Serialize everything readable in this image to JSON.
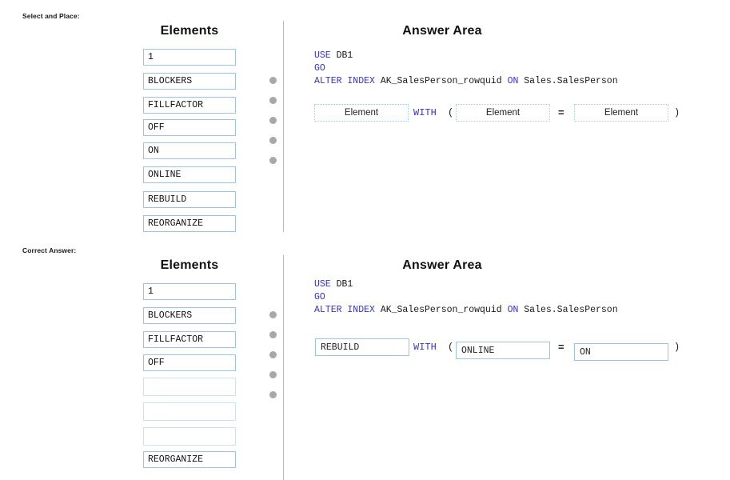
{
  "sections": [
    {
      "label": "Select and Place:",
      "elements_heading": "Elements",
      "answer_heading": "Answer Area",
      "elements": [
        {
          "text": "1",
          "empty": false
        },
        {
          "text": "BLOCKERS",
          "empty": false
        },
        {
          "text": "FILLFACTOR",
          "empty": false
        },
        {
          "text": "OFF",
          "empty": false
        },
        {
          "text": "ON",
          "empty": false
        },
        {
          "text": "ONLINE",
          "empty": false
        },
        {
          "text": "REBUILD",
          "empty": false
        },
        {
          "text": "REORGANIZE",
          "empty": false
        }
      ],
      "code": {
        "line1_kw": "USE",
        "line1_rest": " DB1",
        "line2_kw": "GO",
        "line3_kw": "ALTER INDEX",
        "line3_ident": " AK_SalesPerson_rowquid ",
        "line3_on": "ON",
        "line3_table": " Sales.SalesPerson"
      },
      "answer_row": {
        "slot1": "Element",
        "with_keyword": "WITH",
        "open_paren": "(",
        "slot2": "Element",
        "equals": "=",
        "slot3": "Element",
        "close_paren": ")"
      },
      "dots": 5
    },
    {
      "label": "Correct Answer:",
      "elements_heading": "Elements",
      "answer_heading": "Answer Area",
      "elements": [
        {
          "text": "1",
          "empty": false
        },
        {
          "text": "BLOCKERS",
          "empty": false
        },
        {
          "text": "FILLFACTOR",
          "empty": false
        },
        {
          "text": "OFF",
          "empty": false
        },
        {
          "text": "",
          "empty": true
        },
        {
          "text": "",
          "empty": true
        },
        {
          "text": "",
          "empty": true
        },
        {
          "text": "REORGANIZE",
          "empty": false
        }
      ],
      "code": {
        "line1_kw": "USE",
        "line1_rest": " DB1",
        "line2_kw": "GO",
        "line3_kw": "ALTER INDEX",
        "line3_ident": " AK_SalesPerson_rowquid ",
        "line3_on": "ON",
        "line3_table": " Sales.SalesPerson"
      },
      "answer_row": {
        "slot1": "REBUILD",
        "with_keyword": "WITH",
        "open_paren": "(",
        "slot2": "ONLINE",
        "equals": "=",
        "slot3": "ON",
        "close_paren": ")"
      },
      "dots": 5
    }
  ],
  "colors": {
    "keyword_blue": "#3333cc",
    "box_border_blue": "#9dc3e0",
    "empty_box_border": "#cde2f0",
    "dot_gray": "#a8a8a8",
    "divider_gray": "#b9b9b9"
  }
}
